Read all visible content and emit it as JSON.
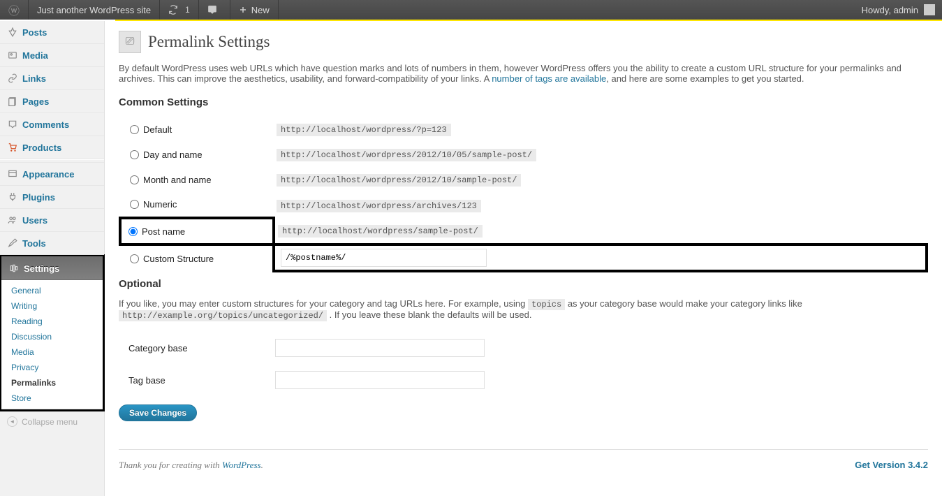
{
  "adminbar": {
    "site_title": "Just another WordPress site",
    "refresh_count": "1",
    "new_label": "New",
    "howdy": "Howdy, admin"
  },
  "sidebar": {
    "posts": "Posts",
    "media": "Media",
    "links": "Links",
    "pages": "Pages",
    "comments": "Comments",
    "products": "Products",
    "appearance": "Appearance",
    "plugins": "Plugins",
    "users": "Users",
    "tools": "Tools",
    "settings": "Settings",
    "settings_sub": {
      "general": "General",
      "writing": "Writing",
      "reading": "Reading",
      "discussion": "Discussion",
      "media": "Media",
      "privacy": "Privacy",
      "permalinks": "Permalinks",
      "store": "Store"
    },
    "collapse": "Collapse menu"
  },
  "page": {
    "title": "Permalink Settings",
    "intro_prefix": "By default WordPress uses web URLs which have question marks and lots of numbers in them, however WordPress offers you the ability to create a custom URL structure for your permalinks and archives. This can improve the aesthetics, usability, and forward-compatibility of your links. A ",
    "intro_link": "number of tags are available",
    "intro_suffix": ", and here are some examples to get you started.",
    "common_heading": "Common Settings",
    "options": {
      "default": {
        "label": "Default",
        "example": "http://localhost/wordpress/?p=123"
      },
      "dayname": {
        "label": "Day and name",
        "example": "http://localhost/wordpress/2012/10/05/sample-post/"
      },
      "monthname": {
        "label": "Month and name",
        "example": "http://localhost/wordpress/2012/10/sample-post/"
      },
      "numeric": {
        "label": "Numeric",
        "example": "http://localhost/wordpress/archives/123"
      },
      "postname": {
        "label": "Post name",
        "example": "http://localhost/wordpress/sample-post/"
      },
      "custom": {
        "label": "Custom Structure",
        "value": "/%postname%/"
      }
    },
    "optional_heading": "Optional",
    "optional_desc_1": "If you like, you may enter custom structures for your category and tag URLs here. For example, using ",
    "optional_code_1": "topics",
    "optional_desc_2": " as your category base would make your category links like ",
    "optional_code_2": "http://example.org/topics/uncategorized/",
    "optional_desc_3": " . If you leave these blank the defaults will be used.",
    "category_base_label": "Category base",
    "tag_base_label": "Tag base",
    "save_button": "Save Changes"
  },
  "footer": {
    "thankyou_prefix": "Thank you for creating with ",
    "thankyou_link": "WordPress",
    "version": "Get Version 3.4.2"
  }
}
